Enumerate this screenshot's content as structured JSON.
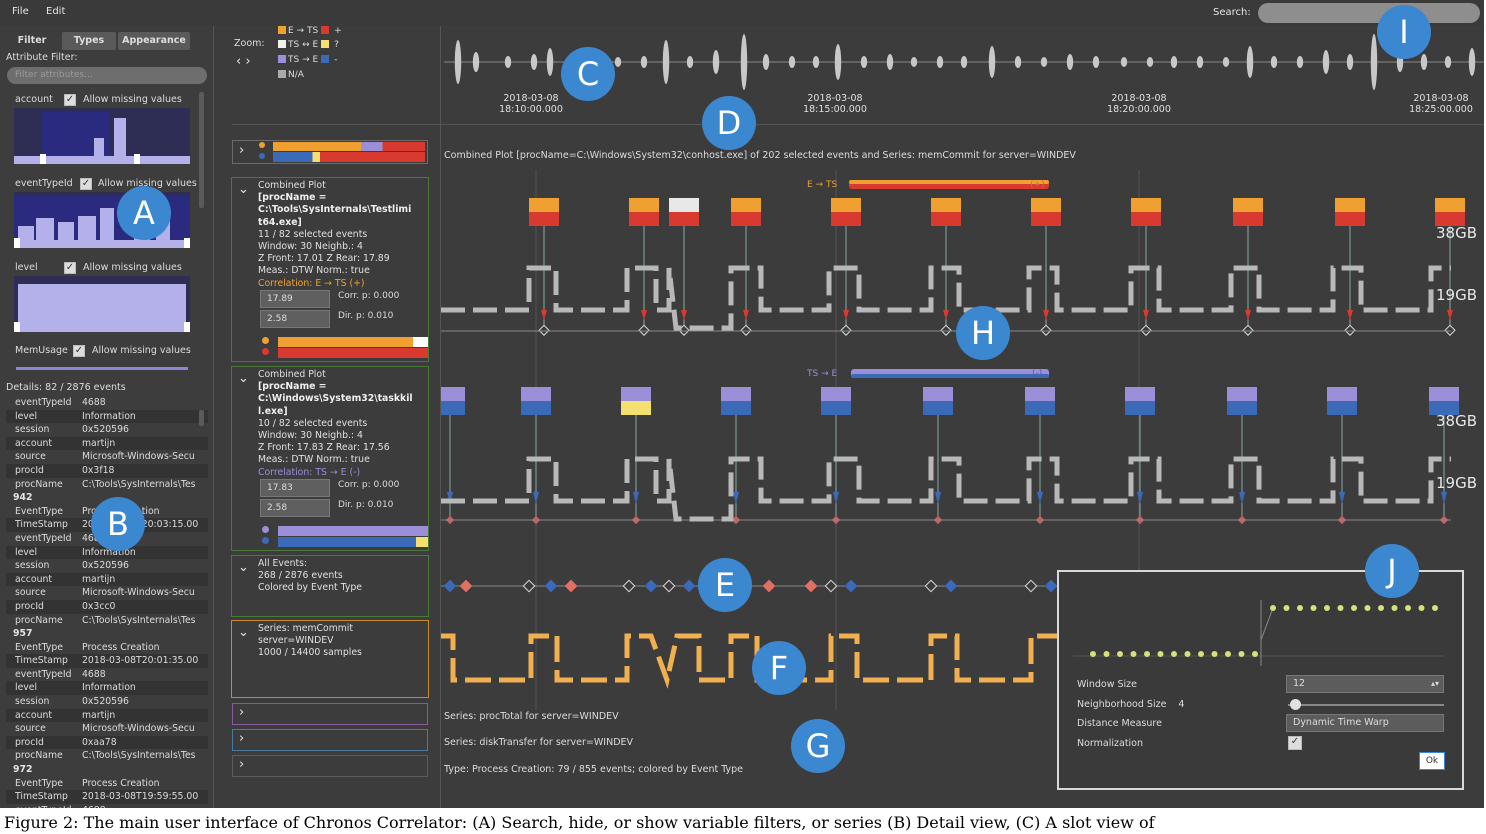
{
  "menu": {
    "file": "File",
    "edit": "Edit",
    "search_label": "Search:"
  },
  "left": {
    "tabs": [
      "Filter",
      "Types",
      "Appearance"
    ],
    "attribute_filter_label": "Attribute Filter:",
    "filter_placeholder": "Filter attributes...",
    "filters": [
      {
        "name": "account",
        "allow": "Allow missing values"
      },
      {
        "name": "eventTypeId",
        "allow": "Allow missing values"
      },
      {
        "name": "level",
        "allow": "Allow missing values"
      },
      {
        "name": "MemUsage",
        "allow": "Allow missing values"
      }
    ],
    "details_label": "Details: 82 / 2876 events",
    "details_rows": [
      {
        "k": "eventTypeId",
        "v": "4688"
      },
      {
        "k": "level",
        "v": "Information"
      },
      {
        "k": "session",
        "v": "0x520596"
      },
      {
        "k": "account",
        "v": "martijn"
      },
      {
        "k": "source",
        "v": "Microsoft-Windows-Secu"
      },
      {
        "k": "procId",
        "v": "0x3f18"
      },
      {
        "k": "procName",
        "v": "C:\\Tools\\SysInternals\\Tes"
      },
      {
        "header": "942"
      },
      {
        "k": "EventType",
        "v": "Process Creation"
      },
      {
        "k": "TimeStamp",
        "v": "2018-03-08T20:03:15.00"
      },
      {
        "k": "eventTypeId",
        "v": "4688"
      },
      {
        "k": "level",
        "v": "Information"
      },
      {
        "k": "session",
        "v": "0x520596"
      },
      {
        "k": "account",
        "v": "martijn"
      },
      {
        "k": "source",
        "v": "Microsoft-Windows-Secu"
      },
      {
        "k": "procId",
        "v": "0x3cc0"
      },
      {
        "k": "procName",
        "v": "C:\\Tools\\SysInternals\\Tes"
      },
      {
        "header": "957"
      },
      {
        "k": "EventType",
        "v": "Process Creation"
      },
      {
        "k": "TimeStamp",
        "v": "2018-03-08T20:01:35.00"
      },
      {
        "k": "eventTypeId",
        "v": "4688"
      },
      {
        "k": "level",
        "v": "Information"
      },
      {
        "k": "session",
        "v": "0x520596"
      },
      {
        "k": "account",
        "v": "martijn"
      },
      {
        "k": "source",
        "v": "Microsoft-Windows-Secu"
      },
      {
        "k": "procId",
        "v": "0xaa78"
      },
      {
        "k": "procName",
        "v": "C:\\Tools\\SysInternals\\Tes"
      },
      {
        "header": "972"
      },
      {
        "k": "EventType",
        "v": "Process Creation"
      },
      {
        "k": "TimeStamp",
        "v": "2018-03-08T19:59:55.00"
      },
      {
        "k": "eventTypeId",
        "v": "4688"
      }
    ]
  },
  "zoom": {
    "label": "Zoom:",
    "legend": [
      {
        "text": "E → TS",
        "colors": [
          "#f0a030",
          "#d83a30"
        ],
        "suffix": "+"
      },
      {
        "text": "TS ↔ E",
        "colors": [
          "#f0f0f0",
          "#f4e070"
        ],
        "suffix": "?"
      },
      {
        "text": "TS → E",
        "colors": [
          "#9a8fd8",
          "#3a6ab8"
        ],
        "suffix": "-"
      },
      {
        "text": "N/A",
        "colors": [
          "#aaaaaa"
        ],
        "suffix": ""
      }
    ]
  },
  "timeline": {
    "ticks": [
      {
        "date": "2018-03-08",
        "time": "18:10:00.000"
      },
      {
        "date": "2018-03-08",
        "time": "18:15:00.000"
      },
      {
        "date": "2018-03-08",
        "time": "18:20:00.000"
      },
      {
        "date": "2018-03-08",
        "time": "18:25:00.000"
      }
    ]
  },
  "combined_caption": "Combined Plot [procName=C:\\Windows\\System32\\conhost.exe] of 202 selected events and Series: memCommit for server=WINDEV",
  "cards": [
    {
      "lines": [
        "Combined Plot",
        "[procName =",
        "C:\\Tools\\SysInternals\\Testlimi",
        "t64.exe]",
        "11 / 82 selected events",
        "Window: 30  Neighb.: 4",
        "Z Front: 17.01 Z Rear: 17.89",
        "Meas.: DTW Norm.: true",
        "Correlation: E → TS (+)"
      ],
      "spin1": "17.89",
      "spin2": "2.58",
      "corr": "Corr. p: 0.000",
      "dir": "Dir. p: 0.010"
    },
    {
      "lines": [
        "Combined Plot",
        "[procName =",
        "C:\\Windows\\System32\\taskkil",
        "l.exe]",
        "10 / 82 selected events",
        "Window: 30  Neighb.: 4",
        "Z Front: 17.83 Z Rear: 17.56",
        "Meas.: DTW Norm.: true",
        "Correlation: TS → E (-)"
      ],
      "spin1": "17.83",
      "spin2": "2.58",
      "corr": "Corr. p: 0.000",
      "dir": "Dir. p: 0.010"
    }
  ],
  "all_events": {
    "l1": "All Events:",
    "l2": "268 / 2876 events",
    "l3": "Colored by Event Type"
  },
  "series_card": {
    "l1": "Series: memCommit",
    "l2": "server=WINDEV",
    "l3": "1000 / 14400 samples"
  },
  "plot_labels": {
    "row1_tag": "E → TS",
    "row1_tag_suffix": "(+)",
    "row2_tag": "TS → E",
    "row2_tag_suffix": "(-)",
    "gb38": "38GB",
    "gb19": "19GB",
    "proc_total": "Series: procTotal for server=WINDEV",
    "disk_transfer": "Series: diskTransfer for server=WINDEV",
    "type_process": "Type: Process Creation: 79 / 855 events; colored by Event Type"
  },
  "dialog": {
    "window_size_label": "Window Size",
    "window_size_value": "12",
    "neighborhood_label": "Neighborhood Size",
    "neighborhood_value": "4",
    "distance_label": "Distance Measure",
    "distance_value": "Dynamic Time Warp",
    "normalization_label": "Normalization",
    "ok": "Ok"
  },
  "callouts": [
    "A",
    "B",
    "C",
    "D",
    "E",
    "F",
    "G",
    "H",
    "I",
    "J"
  ],
  "figure_caption": "Figure 2:  The main user interface of Chronos Correlator:  (A) Search, hide, or show variable filters, or series (B) Detail view, (C) A slot view of"
}
